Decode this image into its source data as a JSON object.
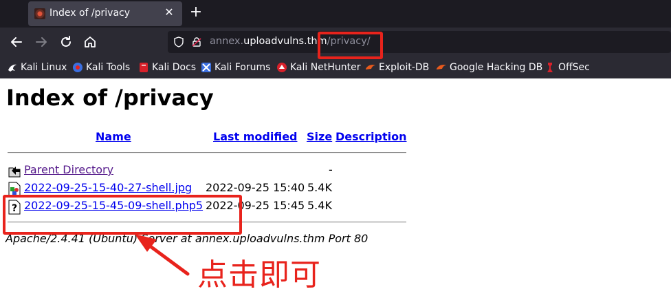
{
  "browser": {
    "tab": {
      "title": "Index of /privacy",
      "close_glyph": "✕"
    },
    "new_tab_glyph": "+",
    "nav": {
      "back_icon": "arrow-left-icon",
      "forward_icon": "arrow-right-icon",
      "reload_icon": "reload-icon",
      "home_icon": "home-icon"
    },
    "url": {
      "prefix": "annex.",
      "host": "uploadvulns.thm",
      "path": "/privacy/"
    },
    "bookmarks": [
      {
        "label": "Kali Linux",
        "icon": "kali-dragon-icon",
        "color": "#ffffff"
      },
      {
        "label": "Kali Tools",
        "icon": "kali-tools-icon",
        "color": "#3b6fe0"
      },
      {
        "label": "Kali Docs",
        "icon": "kali-docs-icon",
        "color": "#d8202a"
      },
      {
        "label": "Kali Forums",
        "icon": "kali-forums-icon",
        "color": "#3b6fe0"
      },
      {
        "label": "Kali NetHunter",
        "icon": "nethunter-icon",
        "color": "#d8202a"
      },
      {
        "label": "Exploit-DB",
        "icon": "exploit-db-icon",
        "color": "#e85a1c"
      },
      {
        "label": "Google Hacking DB",
        "icon": "ghdb-icon",
        "color": "#e85a1c"
      },
      {
        "label": "OffSec",
        "icon": "offsec-icon",
        "color": "#d8202a"
      }
    ]
  },
  "page": {
    "title": "Index of /privacy",
    "columns": {
      "name": "Name",
      "last_modified": "Last modified",
      "size": "Size",
      "description": "Description"
    },
    "rows": [
      {
        "name": "Parent Directory",
        "date": "",
        "size": "-",
        "icon": "back-folder-icon",
        "visited": true
      },
      {
        "name": "2022-09-25-15-40-27-shell.jpg",
        "date": "2022-09-25 15:40",
        "size": "5.4K",
        "icon": "image-file-icon",
        "visited": false
      },
      {
        "name": "2022-09-25-15-45-09-shell.php5",
        "date": "2022-09-25 15:45",
        "size": "5.4K",
        "icon": "unknown-file-icon",
        "visited": false
      }
    ],
    "address": "Apache/2.4.41 (Ubuntu) Server at annex.uploadvulns.thm Port 80"
  },
  "annotation": {
    "text": "点击即可",
    "color": "#e8231c"
  }
}
